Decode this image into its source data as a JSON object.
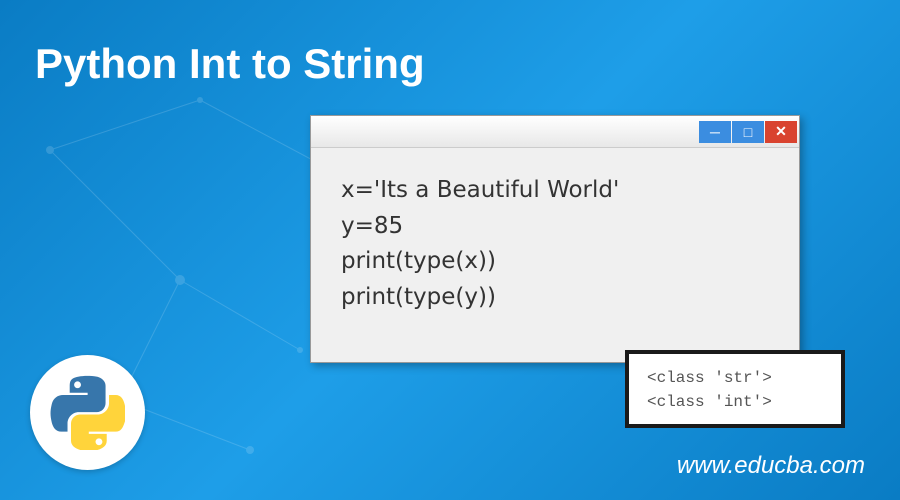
{
  "title": "Python Int to String",
  "code": {
    "line1": "x='Its a Beautiful World'",
    "line2": "y=85",
    "line3": "print(type(x))",
    "line4": "print(type(y))"
  },
  "output": {
    "line1": "<class 'str'>",
    "line2": "<class 'int'>"
  },
  "website": "www.educba.com",
  "icons": {
    "minimize": "─",
    "maximize": "□",
    "close": "✕"
  }
}
